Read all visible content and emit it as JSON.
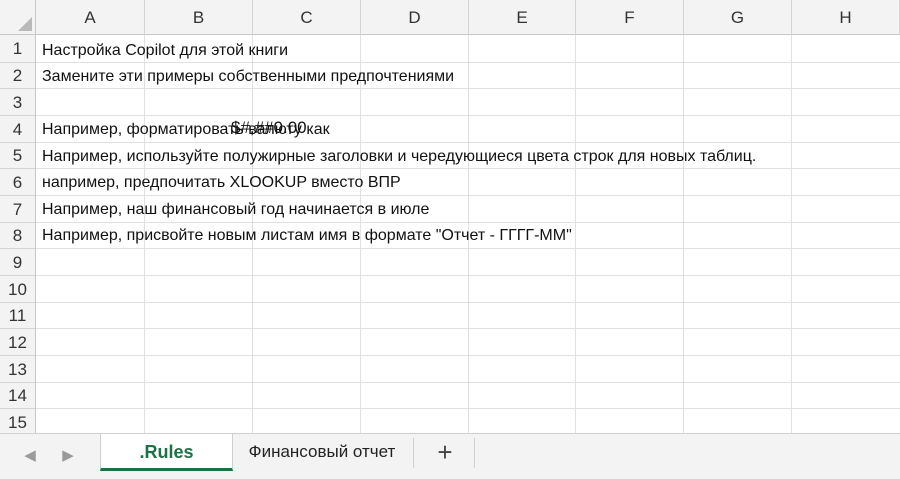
{
  "columns": [
    "A",
    "B",
    "C",
    "D",
    "E",
    "F",
    "G",
    "H"
  ],
  "rows": [
    "1",
    "2",
    "3",
    "4",
    "5",
    "6",
    "7",
    "8",
    "9",
    "10",
    "11",
    "12",
    "13",
    "14",
    "15"
  ],
  "cells": {
    "a1": "Настройка Copilot для этой книги",
    "a2": "Замените эти примеры собственными предпочтениями",
    "a4": "Например, форматировать валюту как",
    "a4_overlay": "$#,##0.00",
    "a5": "Например, используйте полужирные заголовки и чередующиеся цвета строк для новых таблиц.",
    "a6": "например, предпочитать XLOOKUP вместо ВПР",
    "a7": "Например, наш финансовый год начинается в июле",
    "a8": "Например, присвойте новым листам имя в формате \"Отчет - ГГГГ-ММ\""
  },
  "tabs": {
    "prev_icon": "◀",
    "next_icon": "▶",
    "active": ".Rules",
    "second": "Финансовый отчет",
    "add_icon": "+"
  },
  "colors": {
    "active_tab": "#1e7145",
    "header_bg": "#f3f3f3",
    "gridline": "#e1e1e1"
  }
}
